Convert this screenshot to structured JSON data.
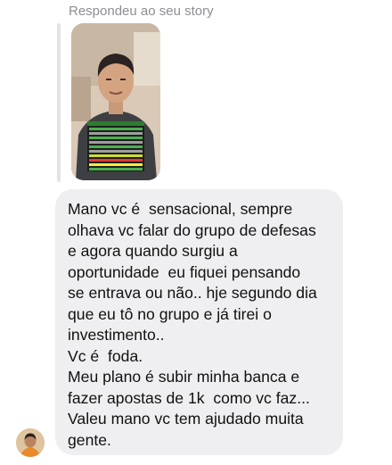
{
  "story_reply": {
    "label": "Respondeu ao seu story"
  },
  "message": {
    "lines": [
      "Mano vc é  sensacional, sempre",
      "olhava vc falar do grupo de defesas",
      "e agora quando surgiu a",
      "oportunidade  eu fiquei pensando",
      "se entrava ou não.. hje segundo dia",
      "que eu tô no grupo e já tirei o",
      "investimento..",
      "Vc é  foda.",
      "Meu plano é subir minha banca e",
      "fazer apostas de 1k  como vc faz...",
      "Valeu mano vc tem ajudado muita",
      "gente."
    ]
  },
  "colors": {
    "bubble_bg": "#efeff1",
    "text": "#111111",
    "label": "#8e8e93",
    "reply_bar": "#e3e3e7"
  }
}
